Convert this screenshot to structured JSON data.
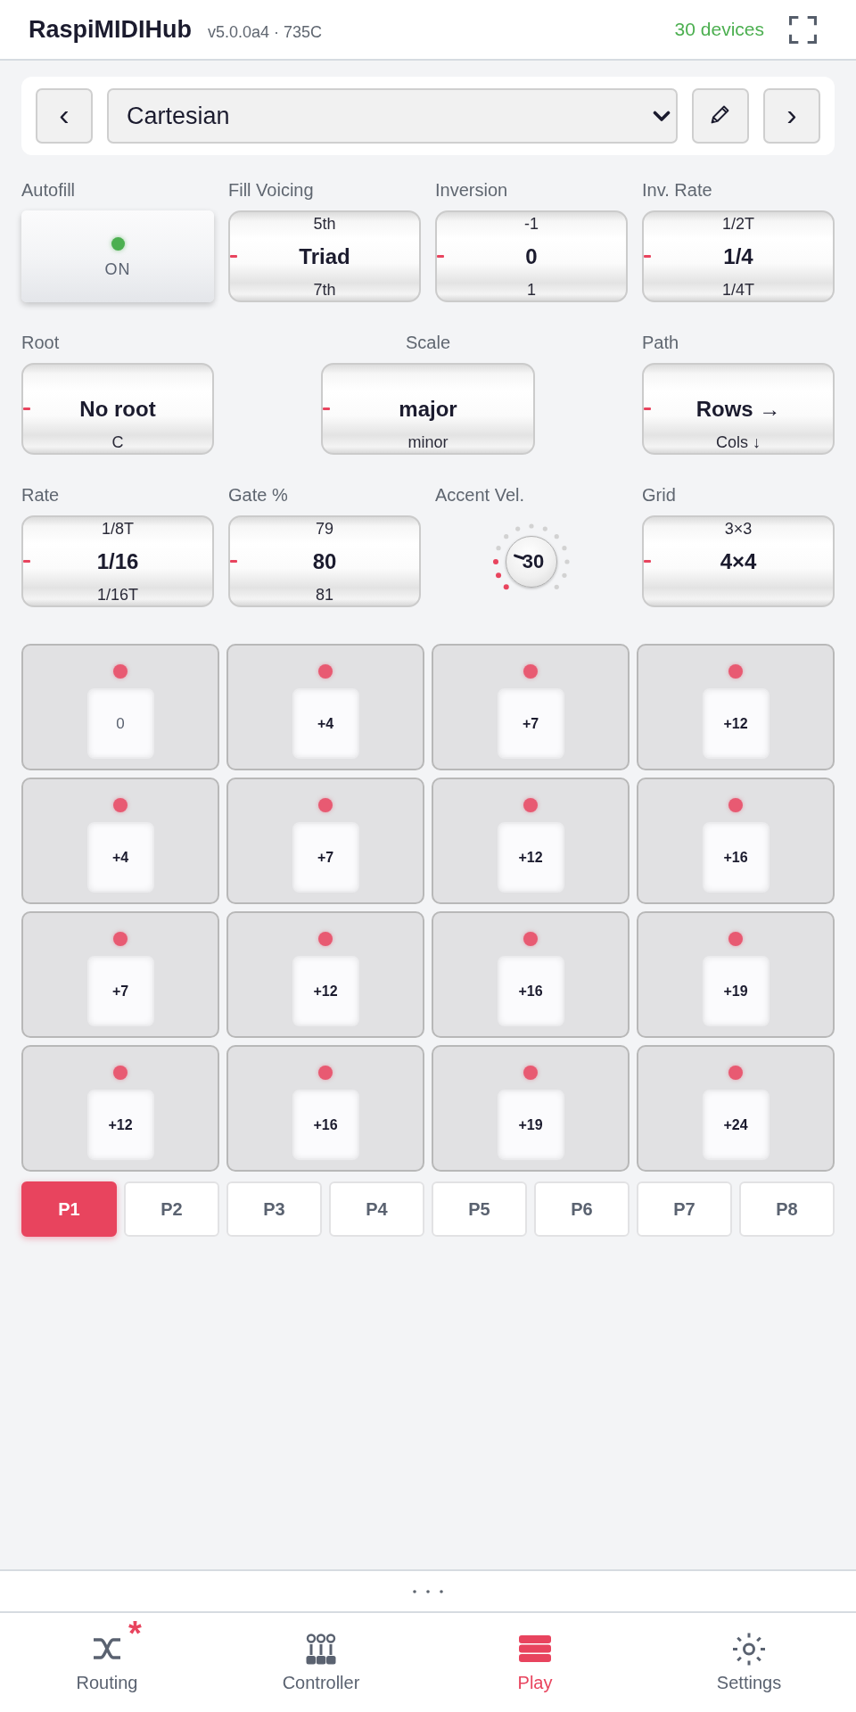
{
  "header": {
    "title": "RaspiMIDIHub",
    "version": "v5.0.0a4 · 735C",
    "devices": "30 devices"
  },
  "preset_bar": {
    "prev": "‹",
    "preset": "Cartesian",
    "next": "›"
  },
  "control_rows": [
    [
      {
        "kind": "toggle",
        "label": "Autofill",
        "on": true,
        "text": "ON"
      },
      {
        "kind": "spinner",
        "label": "Fill Voicing",
        "prev": "5th",
        "value": "Triad",
        "next": "7th"
      },
      {
        "kind": "spinner",
        "label": "Inversion",
        "prev": "-1",
        "value": "0",
        "next": "1"
      },
      {
        "kind": "spinner",
        "label": "Inv. Rate",
        "prev": "1/2T",
        "value": "1/4",
        "next": "1/4T"
      }
    ],
    [
      {
        "kind": "spinner",
        "label": "Root",
        "value": "No root",
        "next": "C"
      },
      {
        "kind": "spinner",
        "label": "Scale",
        "value": "major",
        "next": "minor"
      },
      {
        "kind": "spinner",
        "label": "Path",
        "value": "Rows →",
        "next": "Cols ↓"
      }
    ],
    [
      {
        "kind": "spinner",
        "label": "Rate",
        "prev": "1/8T",
        "value": "1/16",
        "next": "1/16T"
      },
      {
        "kind": "spinner",
        "label": "Gate %",
        "prev": "79",
        "value": "80",
        "next": "81"
      },
      {
        "kind": "knob",
        "label": "Accent Vel.",
        "value": "30",
        "level": 0.236
      },
      {
        "kind": "spinner",
        "label": "Grid",
        "prev": "3×3",
        "value": "4×4"
      }
    ]
  ],
  "pads": [
    {
      "kind": "root",
      "interval": "0"
    },
    {
      "kind": "note",
      "interval": "+4"
    },
    {
      "kind": "note",
      "interval": "+7"
    },
    {
      "kind": "note",
      "interval": "+12"
    },
    {
      "kind": "note",
      "interval": "+4"
    },
    {
      "kind": "note",
      "interval": "+7"
    },
    {
      "kind": "note",
      "interval": "+12"
    },
    {
      "kind": "note",
      "interval": "+16"
    },
    {
      "kind": "note",
      "interval": "+7"
    },
    {
      "kind": "note",
      "interval": "+12"
    },
    {
      "kind": "note",
      "interval": "+16"
    },
    {
      "kind": "note",
      "interval": "+19"
    },
    {
      "kind": "note",
      "interval": "+12"
    },
    {
      "kind": "note",
      "interval": "+16"
    },
    {
      "kind": "note",
      "interval": "+19"
    },
    {
      "kind": "note",
      "interval": "+24"
    }
  ],
  "patterns": [
    {
      "label": "P1",
      "selected": true
    },
    {
      "label": "P2",
      "selected": false
    },
    {
      "label": "P3",
      "selected": false
    },
    {
      "label": "P4",
      "selected": false
    },
    {
      "label": "P5",
      "selected": false
    },
    {
      "label": "P6",
      "selected": false
    },
    {
      "label": "P7",
      "selected": false
    },
    {
      "label": "P8",
      "selected": false
    }
  ],
  "nav": [
    {
      "label": "Routing",
      "selected": false,
      "badge": "*"
    },
    {
      "label": "Controller",
      "selected": false
    },
    {
      "label": "Play",
      "selected": true
    },
    {
      "label": "Settings",
      "selected": false
    }
  ]
}
